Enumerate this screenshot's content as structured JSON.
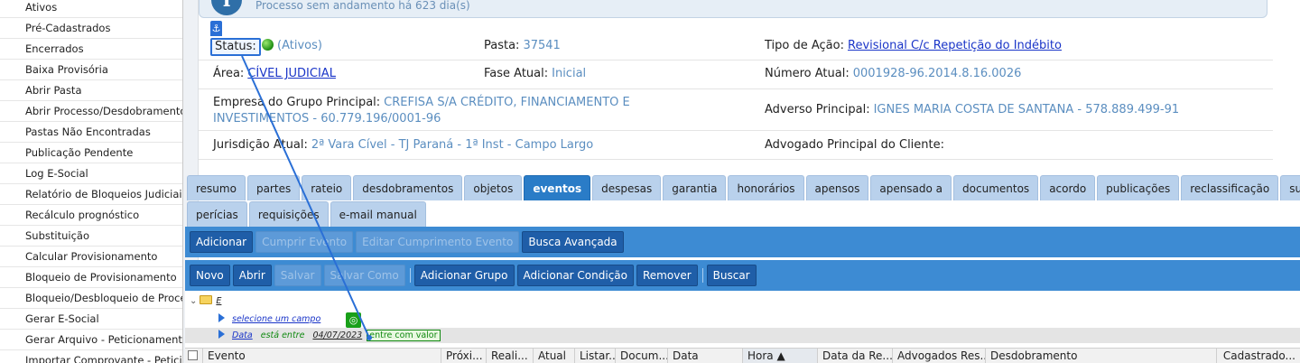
{
  "sidebar": {
    "items": [
      "Ativos",
      "Pré-Cadastrados",
      "Encerrados",
      "Baixa Provisória",
      "Abrir Pasta",
      "Abrir Processo/Desdobramento",
      "Pastas Não Encontradas",
      "Publicação Pendente",
      "Log E-Social",
      "Relatório de Bloqueios Judiciais",
      "Recálculo prognóstico",
      "Substituição",
      "Calcular Provisionamento",
      "Bloqueio de Provisionamento",
      "Bloqueio/Desbloqueio de Processo",
      "Gerar E-Social",
      "Gerar Arquivo - Peticionamento Ele",
      "Importar Comprovante - Peticiona"
    ]
  },
  "banner": {
    "message": "Processo sem andamento há 623 dia(s)"
  },
  "details": {
    "status_label": "Status:",
    "status_value": "(Ativos)",
    "pasta_label": "Pasta:",
    "pasta_value": "37541",
    "tipo_acao_label": "Tipo de Ação:",
    "tipo_acao_value": "Revisional C/c Repetição do Indébito",
    "area_label": "Área:",
    "area_value": "CÍVEL JUDICIAL",
    "fase_label": "Fase Atual:",
    "fase_value": "Inicial",
    "numero_label": "Número Atual:",
    "numero_value": "0001928-96.2014.8.16.0026",
    "empresa_label": "Empresa do Grupo Principal:",
    "empresa_value": "CREFISA S/A CRÉDITO, FINANCIAMENTO E INVESTIMENTOS - 60.779.196/0001-96",
    "adverso_label": "Adverso Principal:",
    "adverso_value": "IGNES MARIA COSTA DE SANTANA - 578.889.499-91",
    "jurisdicao_label": "Jurisdição Atual:",
    "jurisdicao_value": "2ª Vara Cível - TJ Paraná - 1ª Inst - Campo Largo",
    "advogado_label": "Advogado Principal do Cliente:"
  },
  "tabs_row1": [
    "resumo",
    "partes",
    "rateio",
    "desdobramentos",
    "objetos",
    "eventos",
    "despesas",
    "garantia",
    "honorários",
    "apensos",
    "apensado a",
    "documentos",
    "acordo",
    "publicações",
    "reclassificação",
    "substituição"
  ],
  "tabs_row2": [
    "perícias",
    "requisições",
    "e-mail manual"
  ],
  "active_tab": "eventos",
  "toolbar1": {
    "buttons": [
      {
        "label": "Adicionar",
        "enabled": true
      },
      {
        "label": "Cumprir Evento",
        "enabled": false
      },
      {
        "label": "Editar Cumprimento Evento",
        "enabled": false
      },
      {
        "label": "Busca Avançada",
        "enabled": true
      }
    ]
  },
  "toolbar2": {
    "novo": "Novo",
    "abrir": "Abrir",
    "salvar": "Salvar",
    "salvar_como": "Salvar Como",
    "adicionar_grupo": "Adicionar Grupo",
    "adicionar_condicao": "Adicionar Condição",
    "remover": "Remover",
    "buscar": "Buscar"
  },
  "filter": {
    "root": "E",
    "select_field": "selecione um campo",
    "field": "Data",
    "operator": "está entre",
    "date": "04/07/2023",
    "value_prompt": "entre com valor"
  },
  "grid_columns": [
    "Evento",
    "Próxi...",
    "Reali...",
    "Atual",
    "Listar...",
    "Docum...",
    "Data",
    "Hora ▲",
    "Data da Re...",
    "Advogados Res...",
    "Desdobramento",
    "Cadastrado..."
  ],
  "colors": {
    "accent": "#2a7cc7",
    "toolbar": "#3d8bd3",
    "link": "#1a35c8",
    "value": "#5b8ec0",
    "drag": "#2a6fd6"
  }
}
